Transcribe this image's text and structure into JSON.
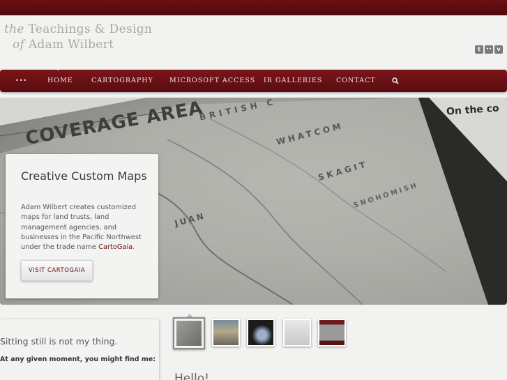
{
  "site": {
    "logo_line1_prefix": "the",
    "logo_line1": "Teachings & Design",
    "logo_line2_prefix": "of",
    "logo_line2": "Adam Wilbert"
  },
  "social": [
    {
      "icon": "tumblr-icon",
      "glyph": "t"
    },
    {
      "icon": "flickr-icon",
      "glyph": "••"
    },
    {
      "icon": "vimeo-icon",
      "glyph": "v"
    }
  ],
  "nav": {
    "more": "•••",
    "items": [
      "HOME",
      "CARTOGRAPHY",
      "MICROSOFT ACCESS",
      "IR GALLERIES",
      "CONTACT"
    ],
    "active": "HOME",
    "search_icon": "search-icon"
  },
  "hero": {
    "map_labels": {
      "coverage": "COVERAGE AREA",
      "british": "BRITISH C",
      "whatcom": "WHATCOM",
      "skagit": "SKAGIT",
      "snohomish": "SNOHOMISH",
      "juan": "JUAN",
      "on_the": "On the co"
    },
    "card": {
      "title": "Creative Custom Maps",
      "body_before": "Adam Wilbert creates customized maps for land trusts, land management agencies, and businesses in the Pacific Northwest under the trade name ",
      "body_link": "CartoGaia",
      "body_after": ".",
      "button": "VISIT CARTOGAIA"
    }
  },
  "thumbnails": [
    {
      "name": "map",
      "selected": true
    },
    {
      "name": "landscape",
      "selected": false
    },
    {
      "name": "presenter",
      "selected": false
    },
    {
      "name": "document",
      "selected": false
    },
    {
      "name": "poster",
      "selected": false
    }
  ],
  "about": {
    "heading": "Sitting still is not my thing.",
    "text": "At any given moment, you might find me:"
  },
  "hello": "Hello!",
  "colors": {
    "brand": "#6e0f13",
    "background": "#f2f2f1"
  }
}
